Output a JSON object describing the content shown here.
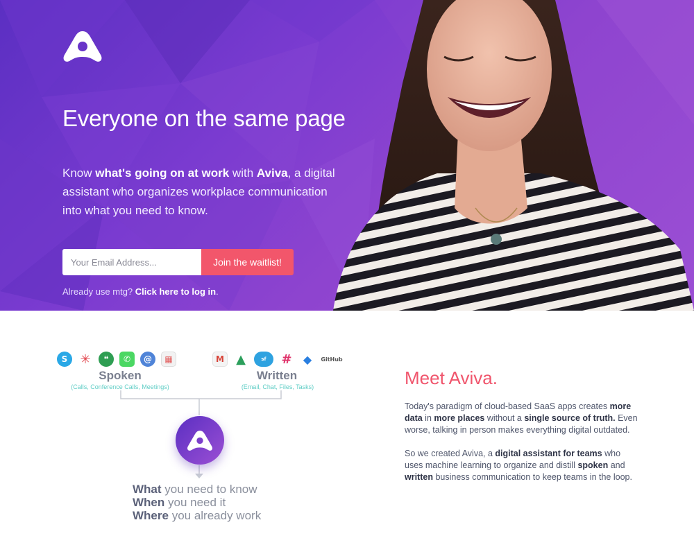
{
  "hero": {
    "title": "Everyone on the same page",
    "subtitle_parts": [
      "Know ",
      "what's going on at work",
      " with ",
      "Aviva",
      ", a digital assistant who organizes workplace communication into what you need to know."
    ],
    "email_placeholder": "Your Email Address...",
    "join_button": "Join the waitlist!",
    "login_prefix": "Already use mtg? ",
    "login_link": "Click here to log in",
    "login_suffix": "."
  },
  "diagram": {
    "spoken_label": "Spoken",
    "spoken_sub": "(Calls, Conference Calls, Meetings)",
    "written_label": "Written",
    "written_sub": "(Email, Chat, Files, Tasks)",
    "github_label": "GitHub",
    "tagline": [
      {
        "bold": "What",
        "rest": " you need to know"
      },
      {
        "bold": "When",
        "rest": " you need it"
      },
      {
        "bold": "Where",
        "rest": " you already work"
      }
    ]
  },
  "meet": {
    "title": "Meet Aviva.",
    "p1": [
      {
        "t": "Today's paradigm of cloud-based SaaS apps creates ",
        "b": false
      },
      {
        "t": "more data",
        "b": true
      },
      {
        "t": " in ",
        "b": false
      },
      {
        "t": "more places",
        "b": true
      },
      {
        "t": " without a ",
        "b": false
      },
      {
        "t": "single source of truth.",
        "b": true
      },
      {
        "t": " Even worse, talking in person makes everything digital outdated.",
        "b": false
      }
    ],
    "p2": [
      {
        "t": "So we created Aviva, a ",
        "b": false
      },
      {
        "t": "digital assistant for teams",
        "b": true
      },
      {
        "t": " who uses machine learning to organize and distill ",
        "b": false
      },
      {
        "t": "spoken",
        "b": true
      },
      {
        "t": " and ",
        "b": false
      },
      {
        "t": "written",
        "b": true
      },
      {
        "t": " business communication to keep teams in the loop.",
        "b": false
      }
    ]
  },
  "colors": {
    "accent": "#f0566d",
    "hero_purple": "#7a3bd0",
    "teal": "#5ecdc5"
  }
}
